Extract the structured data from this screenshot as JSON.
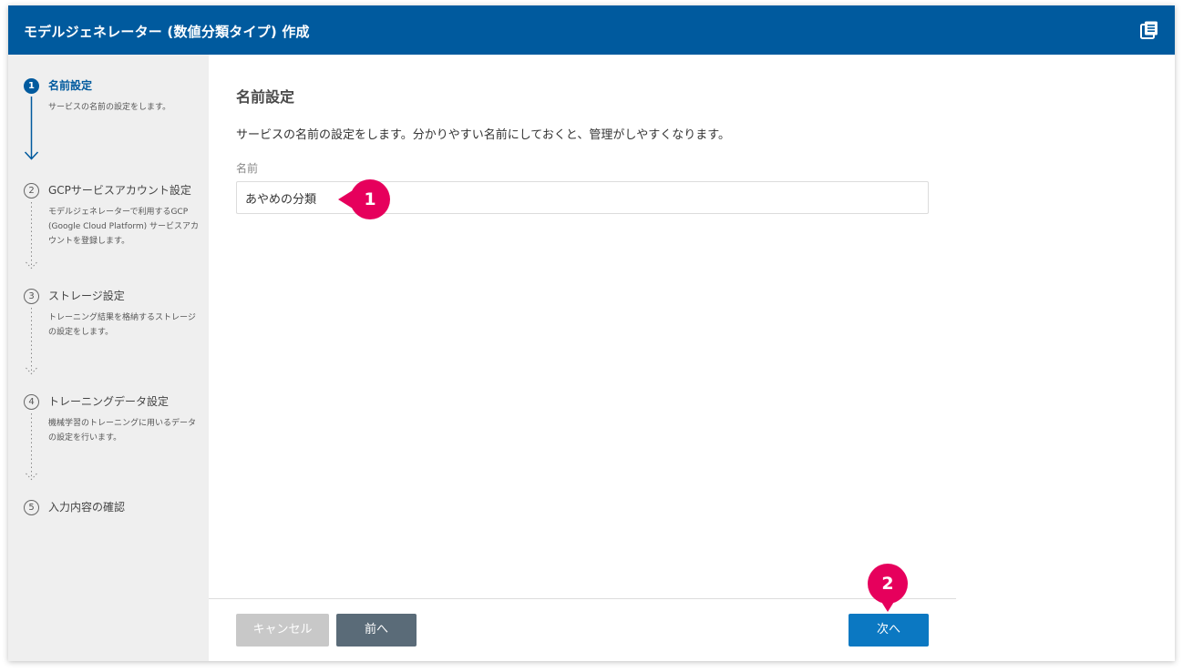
{
  "window": {
    "title": "モデルジェネレーター (数値分類タイプ) 作成",
    "doc_icon": "document-stack-icon"
  },
  "steps": [
    {
      "number": "1",
      "label": "名前設定",
      "description": "サービスの名前の設定をします。",
      "state": "active"
    },
    {
      "number": "2",
      "label": "GCPサービスアカウント設定",
      "description": "モデルジェネレーターで利用するGCP (Google Cloud Platform) サービスアカウントを登録します。",
      "state": "pending"
    },
    {
      "number": "3",
      "label": "ストレージ設定",
      "description": "トレーニング結果を格納するストレージの設定をします。",
      "state": "pending"
    },
    {
      "number": "4",
      "label": "トレーニングデータ設定",
      "description": "機械学習のトレーニングに用いるデータの設定を行います。",
      "state": "pending"
    },
    {
      "number": "5",
      "label": "入力内容の確認",
      "description": "",
      "state": "pending"
    }
  ],
  "main": {
    "title": "名前設定",
    "description": "サービスの名前の設定をします。分かりやすい名前にしておくと、管理がしやすくなります。",
    "name_label": "名前",
    "name_value": "あやめの分類"
  },
  "buttons": {
    "cancel": "キャンセル",
    "prev": "前へ",
    "next": "次へ"
  },
  "markers": {
    "m1": "1",
    "m2": "2"
  },
  "colors": {
    "header": "#005a9e",
    "sidebar": "#efefef",
    "next_button": "#0b78c2",
    "prev_button": "#5a6b78",
    "cancel_button": "#c8c8c8",
    "marker": "#e6005c"
  }
}
